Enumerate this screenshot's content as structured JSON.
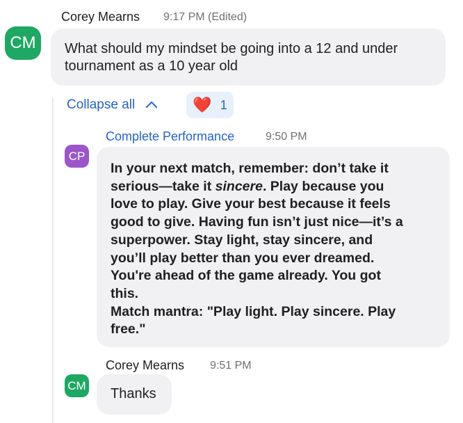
{
  "messages": [
    {
      "avatar_initials": "CM",
      "sender": "Corey Mearns",
      "time": "9:17 PM (Edited)",
      "lines": [
        "What should my mindset be going into a 12 and under",
        "tournament as a 10 year old"
      ]
    }
  ],
  "thread": {
    "collapse_label": "Collapse all",
    "reaction": {
      "emoji": "❤️",
      "count": "1"
    },
    "replies": [
      {
        "avatar_initials": "CP",
        "sender": "Complete Performance",
        "time": "9:50 PM",
        "para": {
          "l1": "In your next match, remember: don’t take it",
          "l2_pre": "serious—take it ",
          "l2_italic": "sincere",
          "l2_post": ". Play because you",
          "l3": "love to play. Give your best because it feels",
          "l4": "good to give. Having fun isn’t just nice—it’s a",
          "l5": "superpower. Stay light, stay sincere, and",
          "l6": "you’ll play better than you ever dreamed.",
          "l7": "You're ahead of the game already. You got",
          "l8": "this.",
          "l9": "Match mantra: \"Play light. Play sincere. Play",
          "l10": "free.\""
        }
      },
      {
        "avatar_initials": "CM",
        "sender": "Corey Mearns",
        "time": "9:51 PM",
        "text": "Thanks"
      }
    ]
  },
  "colors": {
    "avatar_green": "#1ea863",
    "avatar_purple": "#9b56c9",
    "link_blue": "#2563c9",
    "bubble_bg": "#f1f1f4",
    "reaction_bg": "#e7f0fb",
    "heart_red": "#e0243a"
  }
}
